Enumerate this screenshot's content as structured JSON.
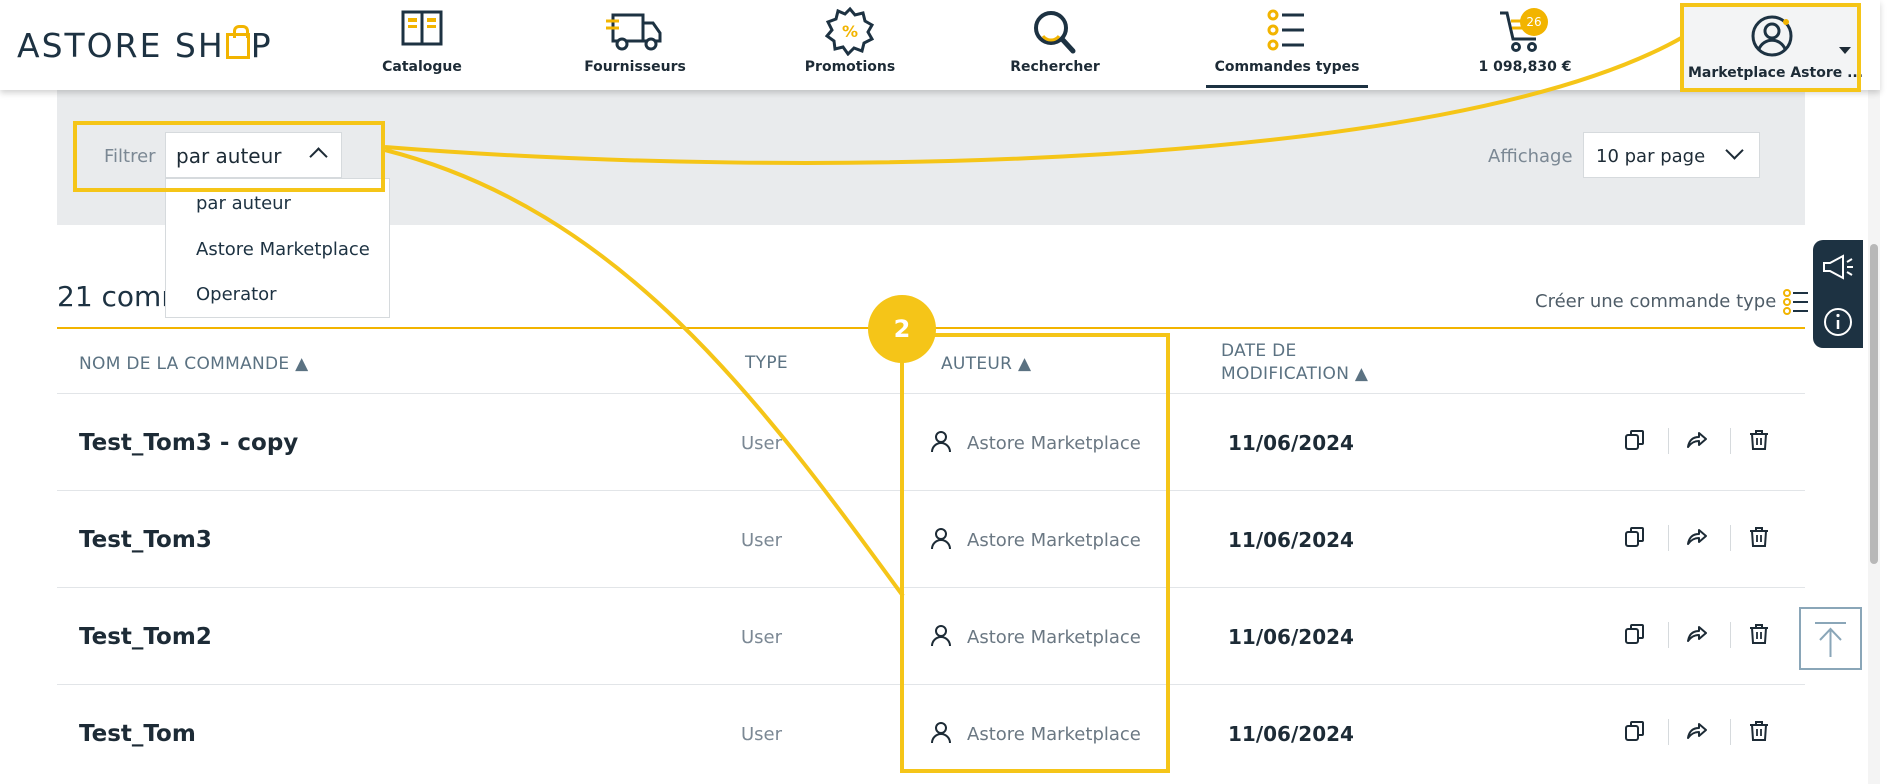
{
  "header": {
    "logo_text_1": "ASTORE SH",
    "logo_text_2": "P",
    "nav": [
      {
        "label": "Catalogue",
        "icon": "book-icon"
      },
      {
        "label": "Fournisseurs",
        "icon": "truck-icon"
      },
      {
        "label": "Promotions",
        "icon": "discount-badge-icon"
      },
      {
        "label": "Rechercher",
        "icon": "search-icon"
      },
      {
        "label": "Commandes types",
        "icon": "list-icon"
      },
      {
        "label": "1 098,830 €",
        "icon": "cart-icon"
      }
    ],
    "cart_count": "26",
    "account_label": "Marketplace Astore ..."
  },
  "filter": {
    "label": "Filtrer",
    "selected": "par auteur",
    "options": [
      "par auteur",
      "Astore Marketplace",
      "Operator"
    ],
    "display_label": "Affichage",
    "display_value": "10 par page"
  },
  "list": {
    "title": "21 comm",
    "create_label": "Créer une commande type",
    "headers": {
      "name": "NOM DE LA COMMANDE ▲",
      "type": "TYPE",
      "author": "AUTEUR ▲",
      "date_1": "DATE DE",
      "date_2": "MODIFICATION ▲"
    },
    "rows": [
      {
        "name": "Test_Tom3 - copy",
        "type": "User",
        "author": "Astore Marketplace",
        "date": "11/06/2024"
      },
      {
        "name": "Test_Tom3",
        "type": "User",
        "author": "Astore Marketplace",
        "date": "11/06/2024"
      },
      {
        "name": "Test_Tom2",
        "type": "User",
        "author": "Astore Marketplace",
        "date": "11/06/2024"
      },
      {
        "name": "Test_Tom",
        "type": "User",
        "author": "Astore Marketplace",
        "date": "11/06/2024"
      }
    ]
  },
  "annotation": {
    "step": "2",
    "color": "#f5c518"
  },
  "colors": {
    "brand_dark": "#1d3242",
    "accent": "#f2b400",
    "filter_bg": "#e9ebed"
  }
}
